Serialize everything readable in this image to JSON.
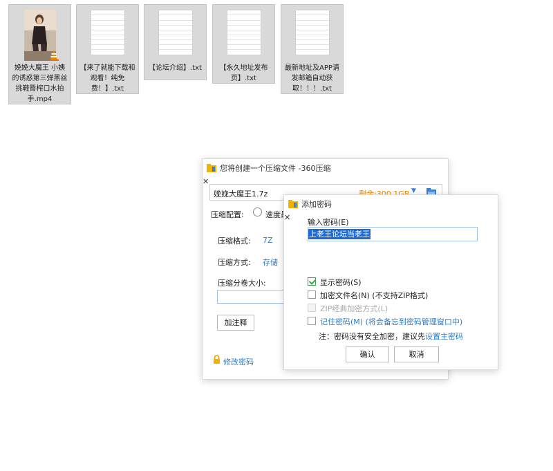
{
  "files": [
    {
      "name": "娩娩大魔王 小姨的诱惑第三弹黑丝挑鞋臀榨口水拍手.mp4",
      "type": "video"
    },
    {
      "name": "【来了就能下载和观看！纯免费！】.txt",
      "type": "text"
    },
    {
      "name": "【论坛介绍】.txt",
      "type": "text"
    },
    {
      "name": "【永久地址发布页】.txt",
      "type": "text"
    },
    {
      "name": "最新地址及APP请发邮箱自动获取！！！.txt",
      "type": "text"
    }
  ],
  "compress_dialog": {
    "title": "您将创建一个压缩文件 -360压缩",
    "filename": "娩娩大魔王1.7z",
    "remaining": "剩余:300.1GB",
    "config_label": "压缩配置:",
    "config_option": "速度最",
    "format_label": "压缩格式:",
    "format_value": "7Z",
    "method_label": "压缩方式:",
    "method_value": "存储",
    "split_label": "压缩分卷大小:",
    "split_value": "",
    "comment_button": "加注释",
    "change_password": "修改密码"
  },
  "password_dialog": {
    "title": "添加密码",
    "input_label": "输入密码(E)",
    "password_value": "上老王论坛当老王",
    "show_password": "显示密码(S)",
    "encrypt_filename": "加密文件名(N) (不支持ZIP格式)",
    "zip_classic": "ZIP经典加密方式(L)",
    "remember_password": "记住密码(M) (将会备忘到密码管理窗口中)",
    "note_prefix": "注：密码没有安全加密，建议先",
    "note_link": "设置主密码",
    "ok_button": "确认",
    "cancel_button": "取消",
    "show_password_checked": true,
    "encrypt_filename_checked": false,
    "zip_classic_checked": false,
    "remember_password_checked": false
  },
  "colors": {
    "accent": "#2f7cc5",
    "remaining": "#f08c00",
    "selection": "#1e6bd6"
  }
}
